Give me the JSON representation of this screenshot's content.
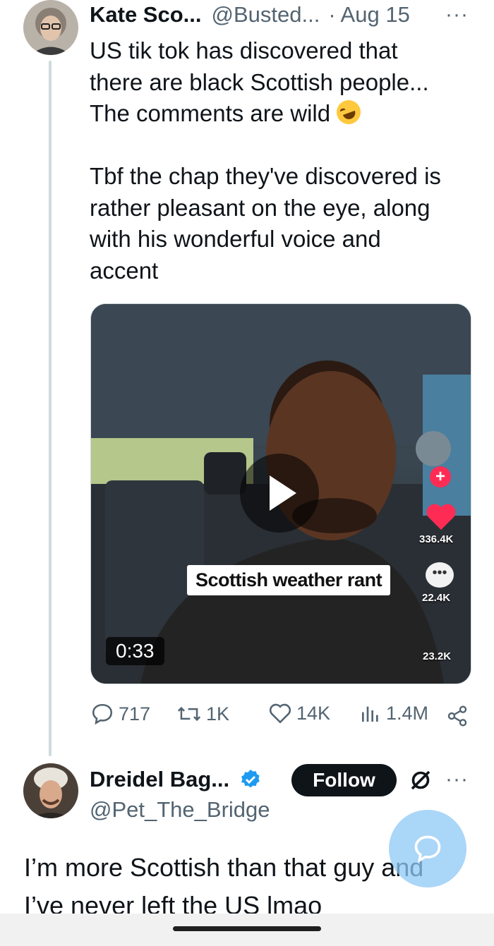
{
  "tweet": {
    "author_name": "Kate Sco...",
    "handle": "@Busted...",
    "date": "· Aug 15",
    "more_glyph": "···",
    "text_lines": [
      "US tik tok has discovered that",
      "there are black Scottish people...",
      "The comments are wild"
    ],
    "text_lines_2": [
      "Tbf the chap they've discovered is",
      "rather pleasant on the eye, along",
      "with his wonderful voice and",
      "accent"
    ],
    "emoji_icon": "rolling-on-floor-laughing-emoji"
  },
  "video": {
    "caption_overlay": "Scottish weather rant",
    "duration": "0:33",
    "tiktok_likes": "336.4K",
    "tiktok_comments": "22.4K",
    "tiktok_shares": "23.2K"
  },
  "actions": {
    "replies": "717",
    "reposts": "1K",
    "likes": "14K",
    "views": "1.4M"
  },
  "reply": {
    "author_name": "Dreidel Bag...",
    "handle": "@Pet_The_Bridge",
    "follow_label": "Follow",
    "more_glyph": "···",
    "text_lines": [
      "I’m more Scottish than that guy and",
      "I’ve never left the US lmao"
    ]
  },
  "colors": {
    "text": "#0f1419",
    "muted": "#536471",
    "verified_blue": "#1d9bf0",
    "fab": "#8dc8f5"
  }
}
